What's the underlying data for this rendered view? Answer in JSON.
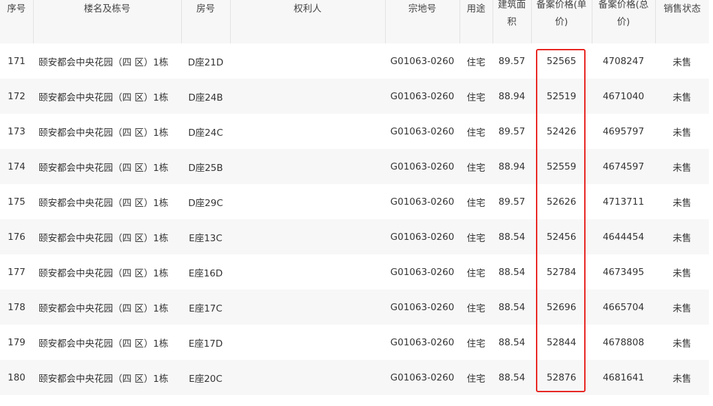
{
  "table": {
    "headers": {
      "seq": "序号",
      "building": "楼名及栋号",
      "room": "房号",
      "owner": "权利人",
      "parcel": "宗地号",
      "usage": "用途",
      "area_line1": "建筑面",
      "area_line2": "积",
      "unit_price_line1": "备案价格(单",
      "unit_price_line2": "价)",
      "total_price_line1": "备案价格(总",
      "total_price_line2": "价)",
      "status": "销售状态"
    },
    "rows": [
      {
        "seq": "171",
        "building": "颐安都会中央花园（四 区）1栋",
        "room": "D座21D",
        "owner": "",
        "parcel": "G01063-0260",
        "usage": "住宅",
        "area": "89.57",
        "unit_price": "52565",
        "total_price": "4708247",
        "status": "未售"
      },
      {
        "seq": "172",
        "building": "颐安都会中央花园（四 区）1栋",
        "room": "D座24B",
        "owner": "",
        "parcel": "G01063-0260",
        "usage": "住宅",
        "area": "88.94",
        "unit_price": "52519",
        "total_price": "4671040",
        "status": "未售"
      },
      {
        "seq": "173",
        "building": "颐安都会中央花园（四 区）1栋",
        "room": "D座24C",
        "owner": "",
        "parcel": "G01063-0260",
        "usage": "住宅",
        "area": "89.57",
        "unit_price": "52426",
        "total_price": "4695797",
        "status": "未售"
      },
      {
        "seq": "174",
        "building": "颐安都会中央花园（四 区）1栋",
        "room": "D座25B",
        "owner": "",
        "parcel": "G01063-0260",
        "usage": "住宅",
        "area": "88.94",
        "unit_price": "52559",
        "total_price": "4674597",
        "status": "未售"
      },
      {
        "seq": "175",
        "building": "颐安都会中央花园（四 区）1栋",
        "room": "D座29C",
        "owner": "",
        "parcel": "G01063-0260",
        "usage": "住宅",
        "area": "89.57",
        "unit_price": "52626",
        "total_price": "4713711",
        "status": "未售"
      },
      {
        "seq": "176",
        "building": "颐安都会中央花园（四 区）1栋",
        "room": "E座13C",
        "owner": "",
        "parcel": "G01063-0260",
        "usage": "住宅",
        "area": "88.54",
        "unit_price": "52456",
        "total_price": "4644454",
        "status": "未售"
      },
      {
        "seq": "177",
        "building": "颐安都会中央花园（四 区）1栋",
        "room": "E座16D",
        "owner": "",
        "parcel": "G01063-0260",
        "usage": "住宅",
        "area": "88.54",
        "unit_price": "52784",
        "total_price": "4673495",
        "status": "未售"
      },
      {
        "seq": "178",
        "building": "颐安都会中央花园（四 区）1栋",
        "room": "E座17C",
        "owner": "",
        "parcel": "G01063-0260",
        "usage": "住宅",
        "area": "88.54",
        "unit_price": "52696",
        "total_price": "4665704",
        "status": "未售"
      },
      {
        "seq": "179",
        "building": "颐安都会中央花园（四 区）1栋",
        "room": "E座17D",
        "owner": "",
        "parcel": "G01063-0260",
        "usage": "住宅",
        "area": "88.54",
        "unit_price": "52844",
        "total_price": "4678808",
        "status": "未售"
      },
      {
        "seq": "180",
        "building": "颐安都会中央花园（四 区）1栋",
        "room": "E座20C",
        "owner": "",
        "parcel": "G01063-0260",
        "usage": "住宅",
        "area": "88.54",
        "unit_price": "52876",
        "total_price": "4681641",
        "status": "未售"
      }
    ]
  },
  "colors": {
    "highlight": "#e8231f",
    "header_bg": "#f7f7f7",
    "stripe_bg": "#f7f7f7"
  }
}
